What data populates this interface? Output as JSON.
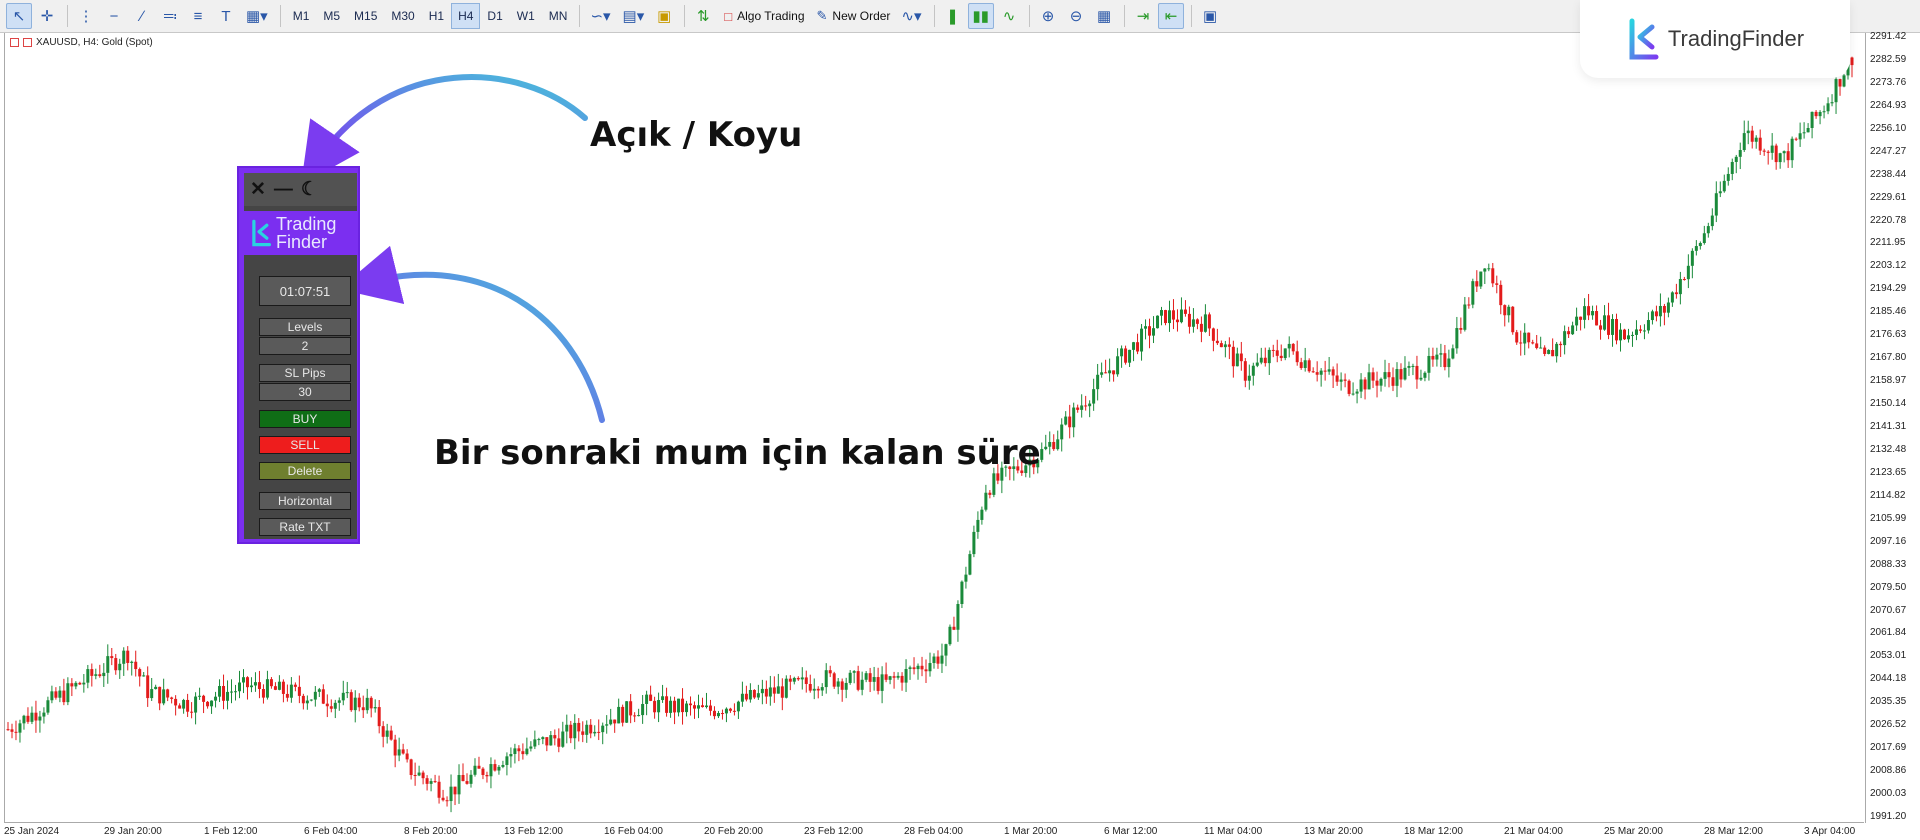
{
  "toolbar": {
    "timeframes": [
      "M1",
      "M5",
      "M15",
      "M30",
      "H1",
      "H4",
      "D1",
      "W1",
      "MN"
    ],
    "active_timeframe": "H4",
    "algo_trading_label": "Algo Trading",
    "new_order_label": "New Order"
  },
  "chart": {
    "symbol_label": "XAUUSD, H4:  Gold (Spot)",
    "price_ticks": [
      "2291.42",
      "2282.59",
      "2273.76",
      "2264.93",
      "2256.10",
      "2247.27",
      "2238.44",
      "2229.61",
      "2220.78",
      "2211.95",
      "2203.12",
      "2194.29",
      "2185.46",
      "2176.63",
      "2167.80",
      "2158.97",
      "2150.14",
      "2141.31",
      "2132.48",
      "2123.65",
      "2114.82",
      "2105.99",
      "2097.16",
      "2088.33",
      "2079.50",
      "2070.67",
      "2061.84",
      "2053.01",
      "2044.18",
      "2035.35",
      "2026.52",
      "2017.69",
      "2008.86",
      "2000.03",
      "1991.20"
    ],
    "time_ticks": [
      "25 Jan 2024",
      "29 Jan 20:00",
      "1 Feb 12:00",
      "6 Feb 04:00",
      "8 Feb 20:00",
      "13 Feb 12:00",
      "16 Feb 04:00",
      "20 Feb 20:00",
      "23 Feb 12:00",
      "28 Feb 04:00",
      "1 Mar 20:00",
      "6 Mar 12:00",
      "11 Mar 04:00",
      "13 Mar 20:00",
      "18 Mar 12:00",
      "21 Mar 04:00",
      "25 Mar 20:00",
      "28 Mar 12:00",
      "3 Apr 04:00"
    ],
    "bull_color": "#1a8a3a",
    "bear_color": "#e31b1b"
  },
  "chart_data": {
    "type": "candlestick",
    "symbol": "XAUUSD",
    "timeframe": "H4",
    "ylim": [
      1987,
      2294
    ],
    "anchors": [
      [
        0,
        2020
      ],
      [
        20,
        2040
      ],
      [
        30,
        2050
      ],
      [
        35,
        2035
      ],
      [
        45,
        2030
      ],
      [
        60,
        2037
      ],
      [
        80,
        2032
      ],
      [
        90,
        2030
      ],
      [
        100,
        2005
      ],
      [
        110,
        1995
      ],
      [
        125,
        2010
      ],
      [
        140,
        2018
      ],
      [
        160,
        2030
      ],
      [
        175,
        2027
      ],
      [
        190,
        2034
      ],
      [
        205,
        2040
      ],
      [
        220,
        2038
      ],
      [
        235,
        2050
      ],
      [
        245,
        2115
      ],
      [
        260,
        2130
      ],
      [
        275,
        2160
      ],
      [
        290,
        2183
      ],
      [
        300,
        2180
      ],
      [
        310,
        2160
      ],
      [
        320,
        2170
      ],
      [
        335,
        2155
      ],
      [
        350,
        2160
      ],
      [
        360,
        2165
      ],
      [
        370,
        2205
      ],
      [
        378,
        2175
      ],
      [
        385,
        2165
      ],
      [
        395,
        2185
      ],
      [
        405,
        2175
      ],
      [
        415,
        2185
      ],
      [
        425,
        2215
      ],
      [
        435,
        2255
      ],
      [
        445,
        2245
      ],
      [
        455,
        2265
      ],
      [
        462,
        2285
      ]
    ]
  },
  "logo": {
    "text": "TradingFinder"
  },
  "panel": {
    "brand_line1": "Trading",
    "brand_line2": "Finder",
    "timer": "01:07:51",
    "levels_label": "Levels",
    "levels_value": "2",
    "sl_label": "SL Pips",
    "sl_value": "30",
    "buy_label": "BUY",
    "sell_label": "SELL",
    "delete_label": "Delete",
    "horizontal_label": "Horizontal",
    "rate_label": "Rate TXT"
  },
  "annotations": {
    "theme": "Açık / Koyu",
    "timer": "Bir sonraki mum için kalan süre"
  }
}
